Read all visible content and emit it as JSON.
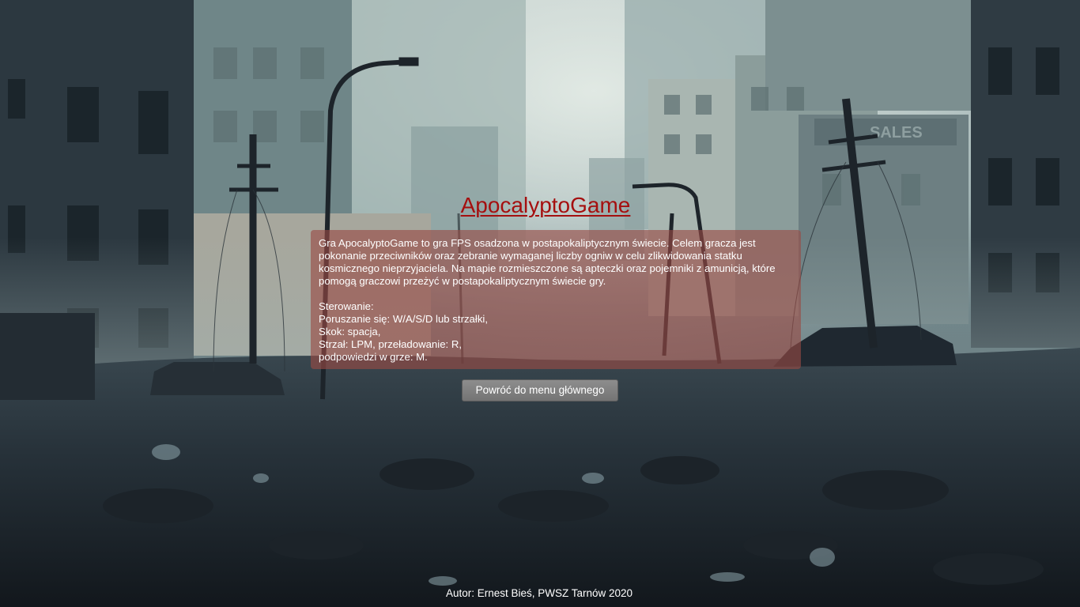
{
  "menu": {
    "title": "ApocalyptoGame",
    "description": "Gra ApocalyptoGame to gra FPS osadzona w postapokaliptycznym świecie. Celem gracza jest pokonanie przeciwników oraz zebranie wymaganej liczby ogniw w celu zlikwidowania statku kosmicznego nieprzyjaciela. Na mapie rozmieszczone są apteczki oraz pojemniki z amunicją, które pomogą graczowi przeżyć w postapokaliptycznym świecie gry.",
    "controls_header": "Sterowanie:",
    "controls": [
      "Poruszanie się: W/A/S/D lub strzałki,",
      "Skok: spacja,",
      "Strzał: LPM, przeładowanie: R,",
      "podpowiedzi w grze: M."
    ],
    "back_button_label": "Powróć do menu głównego",
    "author": "Autor: Ernest Bieś, PWSZ Tarnów 2020"
  },
  "background": {
    "sign_text": "SALES"
  }
}
